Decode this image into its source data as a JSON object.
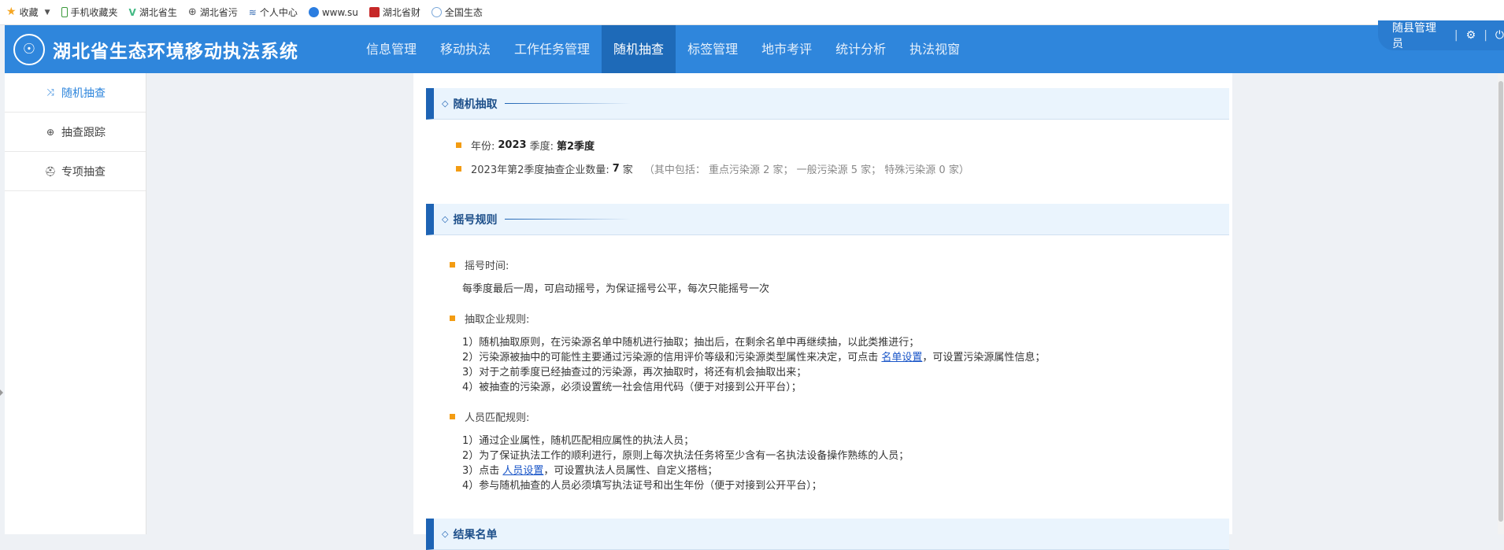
{
  "bookmarks": [
    {
      "label": "收藏",
      "icon": "star-icon"
    },
    {
      "label": "手机收藏夹",
      "icon": "phone-icon"
    },
    {
      "label": "湖北省生",
      "icon": "vue-logo-icon"
    },
    {
      "label": "湖北省污",
      "icon": "globe-icon"
    },
    {
      "label": "个人中心",
      "icon": "layers-icon"
    },
    {
      "label": "www.su",
      "icon": "cloud-icon"
    },
    {
      "label": "湖北省财",
      "icon": "red-logo-icon"
    },
    {
      "label": "全国生态",
      "icon": "eco-logo-icon"
    }
  ],
  "header": {
    "title": "湖北省生态环境移动执法系统",
    "nav": [
      "信息管理",
      "移动执法",
      "工作任务管理",
      "随机抽查",
      "标签管理",
      "地市考评",
      "统计分析",
      "执法视窗"
    ],
    "active_nav": "随机抽查",
    "user": "随县管理员",
    "settings_icon": "gear-icon",
    "power_icon": "power-icon"
  },
  "sidebar": {
    "items": [
      {
        "label": "随机抽查",
        "icon": "shuffle-icon"
      },
      {
        "label": "抽查跟踪",
        "icon": "target-icon"
      },
      {
        "label": "专项抽查",
        "icon": "police-cap-icon"
      }
    ]
  },
  "section1": {
    "title": "随机抽取",
    "year_label": "年份:",
    "year": "2023",
    "quarter_label": "季度:",
    "quarter": "第2季度",
    "count_label": "2023年第2季度抽查企业数量:",
    "count": "7",
    "count_unit": "家",
    "count_detail": "（其中包括：  重点污染源 2 家；  一般污染源 5 家；  特殊污染源 0 家）"
  },
  "section2": {
    "title": "摇号规则",
    "time_title": "摇号时间:",
    "time_text": "每季度最后一周，可启动摇号，为保证摇号公平，每次只能摇号一次",
    "enterprise_title": "抽取企业规则:",
    "enterprise_rules": {
      "r1": "1）随机抽取原则，在污染源名单中随机进行抽取；抽出后，在剩余名单中再继续抽，以此类推进行；",
      "r2_pre": "2）污染源被抽中的可能性主要通过污染源的信用评价等级和污染源类型属性来决定，可点击 ",
      "r2_link": "名单设置",
      "r2_post": "，可设置污染源属性信息；",
      "r3": "3）对于之前季度已经抽查过的污染源，再次抽取时，将还有机会抽取出来；",
      "r4": "4）被抽查的污染源，必须设置统一社会信用代码（便于对接到公开平台）；"
    },
    "staff_title": "人员匹配规则:",
    "staff_rules": {
      "r1": "1）通过企业属性，随机匹配相应属性的执法人员；",
      "r2": "2）为了保证执法工作的顺利进行，原则上每次执法任务将至少含有一名执法设备操作熟练的人员；",
      "r3_pre": "3）点击 ",
      "r3_link": "人员设置",
      "r3_post": "，可设置执法人员属性、自定义搭档；",
      "r4": "4）参与随机抽查的人员必须填写执法证号和出生年份（便于对接到公开平台）；"
    }
  },
  "section3": {
    "title": "结果名单"
  }
}
